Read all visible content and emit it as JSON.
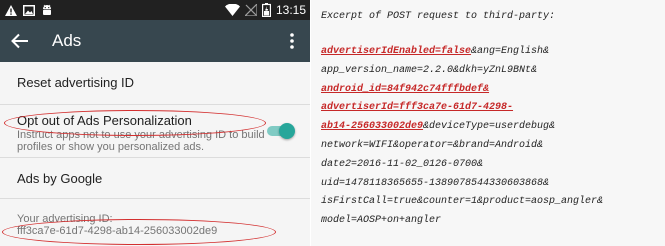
{
  "phone": {
    "statusbar": {
      "time": "13:15",
      "icons": [
        "warning-icon",
        "image-icon",
        "android-icon",
        "wifi-icon",
        "no-signal-icon",
        "battery-icon"
      ]
    },
    "appbar": {
      "title": "Ads",
      "icons": [
        "back-arrow-icon",
        "overflow-menu-icon"
      ]
    },
    "settings": {
      "reset_label": "Reset advertising ID",
      "opt_out_title": "Opt out of Ads Personalization",
      "opt_out_summary_line1": "Instruct apps not to use your advertising ID to build",
      "opt_out_summary_line2": "profiles or show you personalized ads.",
      "opt_out_enabled": true,
      "ads_by_google_label": "Ads by Google",
      "advertising_id_title": "Your advertising ID:",
      "advertising_id_value": "fff3ca7e-61d7-4298-ab14-256033002de9"
    },
    "colors": {
      "status_bar": "#212121",
      "app_bar": "#37474f",
      "toggle_accent": "#26a69a",
      "annotation": "#d32f2f"
    }
  },
  "code": {
    "heading": "Excerpt of POST request to third-party:",
    "lines": [
      [
        {
          "t": "advertiserIdEnabled=false",
          "h": true
        },
        {
          "t": "&ang=English&",
          "h": false
        }
      ],
      [
        {
          "t": "app_version_name=2.2.0&dkh=yZnL9BNt&",
          "h": false
        }
      ],
      [
        {
          "t": "android_id=84f942c74fffbdef&",
          "h": true
        }
      ],
      [
        {
          "t": "advertiserId=fff3ca7e-61d7-4298-",
          "h": true
        }
      ],
      [
        {
          "t": "ab14-256033002de9",
          "h": true
        },
        {
          "t": "&deviceType=userdebug&",
          "h": false
        }
      ],
      [
        {
          "t": "network=WIFI&operator=&brand=Android&",
          "h": false
        }
      ],
      [
        {
          "t": "date2=2016-11-02_0126-0700&",
          "h": false
        }
      ],
      [
        {
          "t": "uid=1478118365655-1389078544330603868&",
          "h": false
        }
      ],
      [
        {
          "t": "isFirstCall=true&counter=1&product=aosp_angler&",
          "h": false
        }
      ],
      [
        {
          "t": "model=AOSP+on+angler",
          "h": false
        }
      ]
    ],
    "colors": {
      "highlight": "#c62828",
      "text": "#222222"
    }
  }
}
